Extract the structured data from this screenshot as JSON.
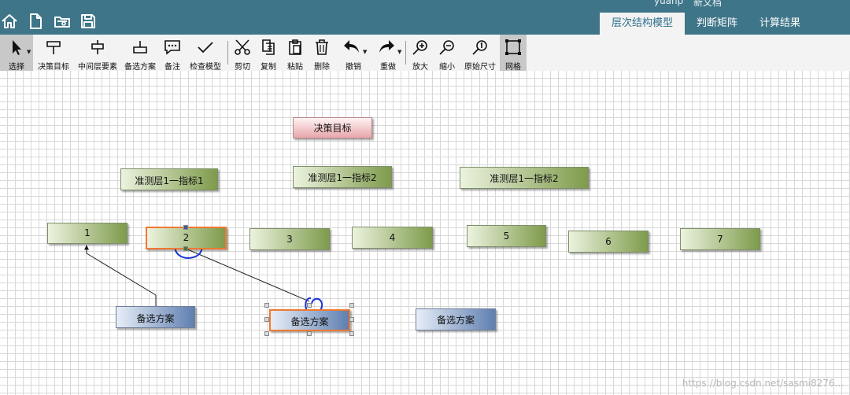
{
  "header": {
    "user_partial": "yuanp",
    "doc_partial": "新文档",
    "tabs": [
      {
        "label": "层次结构模型",
        "active": true
      },
      {
        "label": "判断矩阵",
        "active": false
      },
      {
        "label": "计算结果",
        "active": false
      }
    ]
  },
  "quick_icons": [
    "home-icon",
    "new-file-icon",
    "open-folder-icon",
    "save-icon"
  ],
  "toolbar": {
    "tools": [
      {
        "label": "选择",
        "icon": "pointer-icon",
        "dropdown": true
      },
      {
        "label": "决策目标",
        "icon": "goal-node-icon"
      },
      {
        "label": "中间层要素",
        "icon": "criteria-node-icon"
      },
      {
        "label": "备选方案",
        "icon": "alternative-node-icon"
      },
      {
        "label": "备注",
        "icon": "comment-icon"
      },
      {
        "label": "检查模型",
        "icon": "check-icon"
      },
      {
        "label": "剪切",
        "icon": "scissors-icon"
      },
      {
        "label": "复制",
        "icon": "copy-icon"
      },
      {
        "label": "粘贴",
        "icon": "paste-icon"
      },
      {
        "label": "删除",
        "icon": "trash-icon"
      },
      {
        "label": "撤销",
        "icon": "undo-icon",
        "dropdown": true
      },
      {
        "label": "重做",
        "icon": "redo-icon",
        "dropdown": true
      },
      {
        "label": "放大",
        "icon": "zoom-in-icon"
      },
      {
        "label": "缩小",
        "icon": "zoom-out-icon"
      },
      {
        "label": "原始尺寸",
        "icon": "actual-size-icon"
      },
      {
        "label": "网格",
        "icon": "grid-icon",
        "active": true
      }
    ]
  },
  "canvas": {
    "goal": {
      "label": "决策目标"
    },
    "criteria": [
      {
        "label": "准测层1一指标1"
      },
      {
        "label": "准测层1一指标2"
      },
      {
        "label": "准测层1一指标2"
      }
    ],
    "subcriteria": [
      {
        "label": "1"
      },
      {
        "label": "2",
        "selected": true
      },
      {
        "label": "3"
      },
      {
        "label": "4"
      },
      {
        "label": "5"
      },
      {
        "label": "6"
      },
      {
        "label": "7"
      }
    ],
    "alternatives": [
      {
        "label": "备选方案"
      },
      {
        "label": "备选方案",
        "selected": true
      },
      {
        "label": "备选方案"
      }
    ]
  },
  "watermark": "https://blog.csdn.net/sasmi8276..."
}
